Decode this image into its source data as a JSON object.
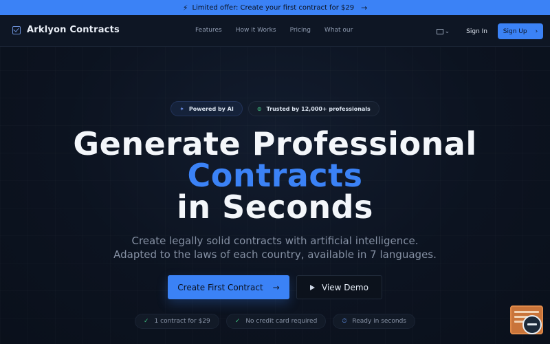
{
  "banner": {
    "icon": "bolt-icon",
    "text": "Limited offer: Create your first contract for $29",
    "arrow": "→"
  },
  "nav": {
    "brand": "Arklyon Contracts",
    "links": [
      "Features",
      "How it Works",
      "Pricing",
      "What our"
    ],
    "language_chevron": "⌄",
    "signin": "Sign In",
    "signup": "Sign Up",
    "signup_chevron": "›"
  },
  "badges": {
    "ai": "Powered by AI",
    "trust": "Trusted by 12,000+ professionals"
  },
  "hero": {
    "line1": "Generate Professional",
    "line2": "Contracts",
    "line3": "in Seconds",
    "sub1": "Create legally solid contracts with artificial intelligence.",
    "sub2": "Adapted to the laws of each country, available in 7 languages."
  },
  "cta": {
    "primary": "Create First Contract",
    "primary_arrow": "→",
    "demo": "View Demo"
  },
  "features": [
    "1 contract for $29",
    "No credit card required",
    "Ready in seconds"
  ],
  "colors": {
    "accent": "#3b82f6",
    "background": "#0c1320",
    "check_green": "#3fbf7f",
    "helper_orange": "#c9743a"
  }
}
